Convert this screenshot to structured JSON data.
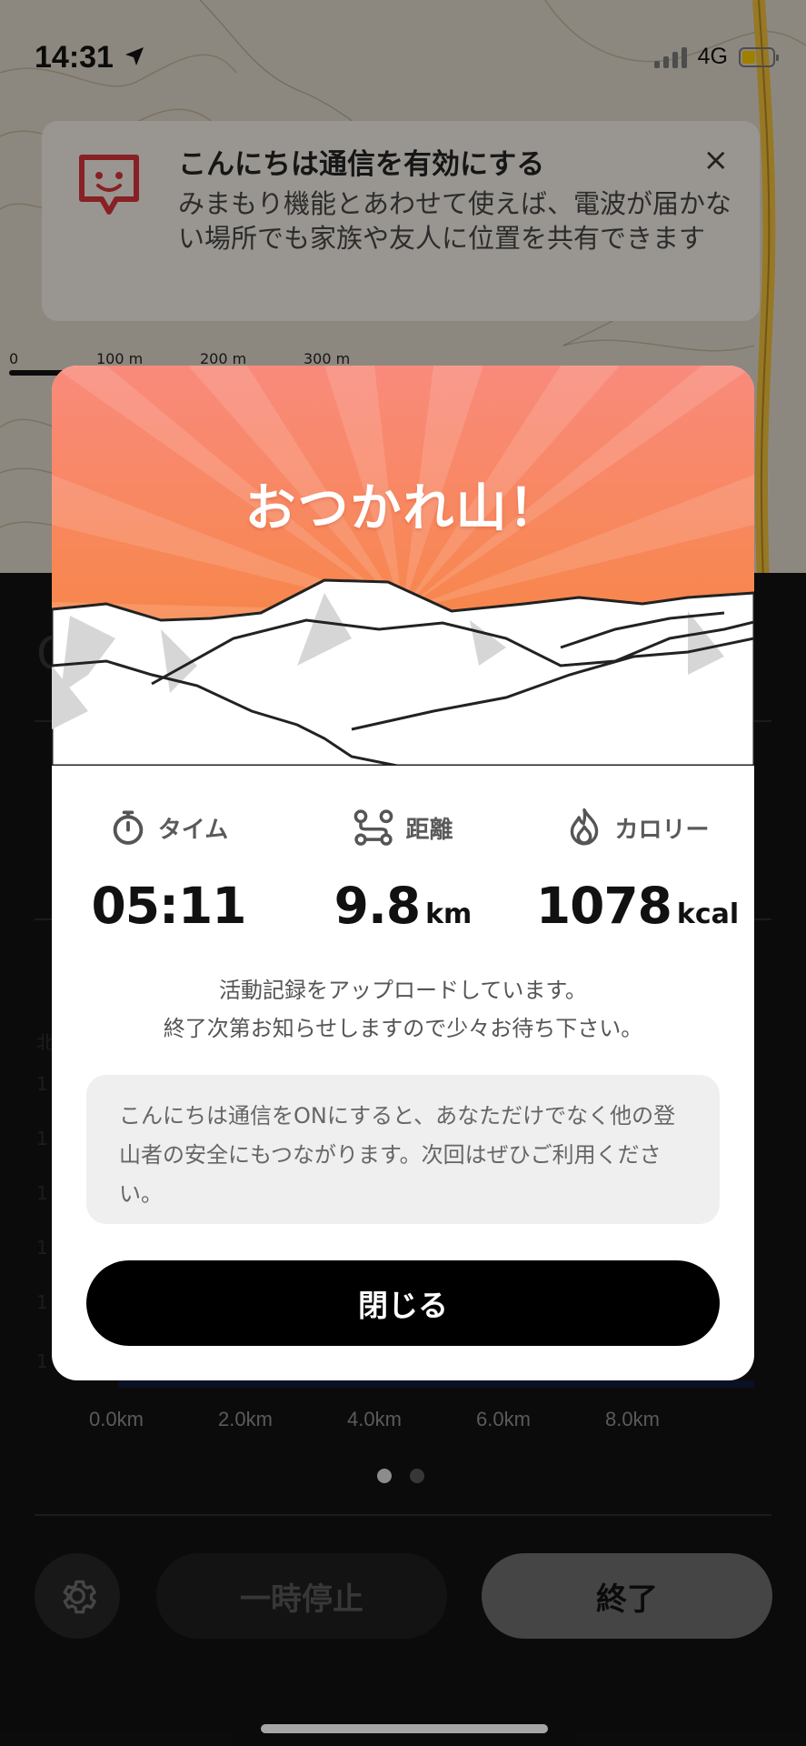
{
  "status_bar": {
    "time": "14:31",
    "network": "4G"
  },
  "notice": {
    "title": "こんにちは通信を有効にする",
    "body": "みまもり機能とあわせて使えば、電波が届かない場所でも家族や友人に位置を共有できます",
    "close": "×"
  },
  "map_scale": {
    "labels": [
      "0",
      "100 m",
      "200 m",
      "300 m"
    ]
  },
  "chart": {
    "x_labels": [
      "0.0km",
      "2.0km",
      "4.0km",
      "6.0km",
      "8.0km"
    ]
  },
  "pager": {
    "active_color": "#d8d8d8",
    "inactive_color": "#555555"
  },
  "controls": {
    "pause_label": "一時停止",
    "end_label": "終了"
  },
  "modal": {
    "title": "おつかれ山！",
    "stats": {
      "time": {
        "label": "タイム",
        "value": "05:11",
        "icon": "stopwatch-icon"
      },
      "distance": {
        "label": "距離",
        "value": "9.8",
        "unit": "km",
        "icon": "route-icon"
      },
      "calories": {
        "label": "カロリー",
        "value": "1078",
        "unit": "kcal",
        "icon": "flame-icon"
      }
    },
    "upload_line1": "活動記録をアップロードしています。",
    "upload_line2": "終了次第お知らせしますので少々お待ち下さい。",
    "info": "こんにちは通信をONにすると、あなただけでなく他の登山者の安全にもつながります。次回はぜひご利用ください。",
    "close_label": "閉じる"
  },
  "colors": {
    "accent_red": "#d0333a",
    "sunrise_top": "#f98a7c",
    "sunrise_bottom": "#f06f2c"
  }
}
